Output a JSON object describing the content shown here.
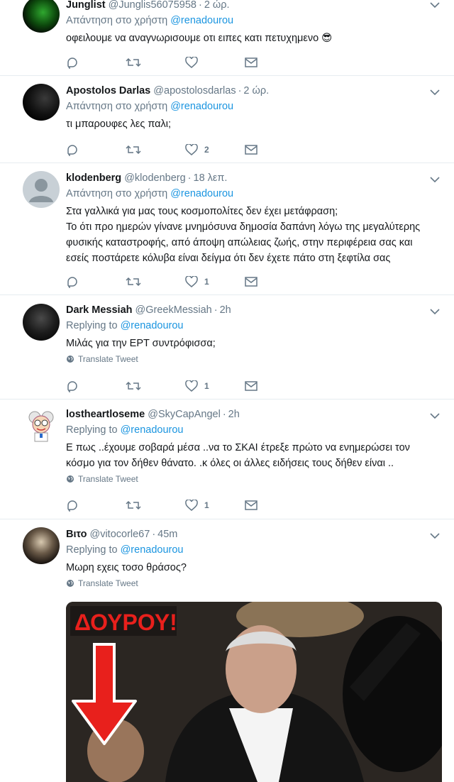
{
  "colors": {
    "accent": "#1b95e0",
    "muted": "#657786",
    "text": "#14171a",
    "divider": "#e6ecf0"
  },
  "tweets": [
    {
      "name": "Junglist",
      "handle": "@Junglis56075958",
      "time": "2 ώρ.",
      "reply_prefix": "Απάντηση στο χρήστη",
      "reply_to": "@renadourou",
      "text": "οφειλουμε να αναγνωρισουμε οτι ειπες κατι πετυχημενο 😎",
      "likes": ""
    },
    {
      "name": "Apostolos Darlas",
      "handle": "@apostolosdarlas",
      "time": "2 ώρ.",
      "reply_prefix": "Απάντηση στο χρήστη",
      "reply_to": "@renadourou",
      "text": "τι μπαρουφες λες παλι;",
      "likes": "2"
    },
    {
      "name": "klodenberg",
      "handle": "@klodenberg",
      "time": "18 λεπ.",
      "reply_prefix": "Απάντηση στο χρήστη",
      "reply_to": "@renadourou",
      "text_lines": [
        "Στα γαλλικά για μας τους κοσμοπολίτες δεν έχει μετάφραση;",
        "Το ότι προ ημερών γίνανε μνημόσυνα δημοσία δαπάνη λόγω της μεγαλύτερης",
        "φυσικής καταστροφής, από άποψη απώλειας ζωής, στην περιφέρεια σας και",
        "εσείς ποστάρετε κόλυβα είναι δείγμα ότι δεν έχετε πάτο στη ξεφτίλα σας"
      ],
      "likes": "1"
    },
    {
      "name": "Dark Messiah",
      "handle": "@GreekMessiah",
      "time": "2h",
      "reply_prefix": "Replying to",
      "reply_to": "@renadourou",
      "text": "Μιλάς για την ΕΡΤ συντρόφισσα;",
      "translate": "Translate Tweet",
      "likes": "1"
    },
    {
      "name": "lostheartloseme",
      "handle": "@SkyCapAngel",
      "time": "2h",
      "reply_prefix": "Replying to",
      "reply_to": "@renadourou",
      "text_lines": [
        "Ε πως ..έχουμε σοβαρά μέσα ..να το ΣΚΑΙ έτρεξε πρώτο να ενημερώσει τον",
        "κόσμο για τον δήθεν θάνατο. .κ όλες οι άλλες ειδήσεις τους δήθεν είναι .."
      ],
      "translate": "Translate Tweet",
      "likes": "1"
    },
    {
      "name": "Βιτο",
      "handle": "@vitocorle67",
      "time": "45m",
      "reply_prefix": "Replying to",
      "reply_to": "@renadourou",
      "text": "Μωρη εχεις τοσο θράσος?",
      "translate": "Translate Tweet",
      "media_caption": "ΔΟΥΡΟΥ!"
    }
  ]
}
